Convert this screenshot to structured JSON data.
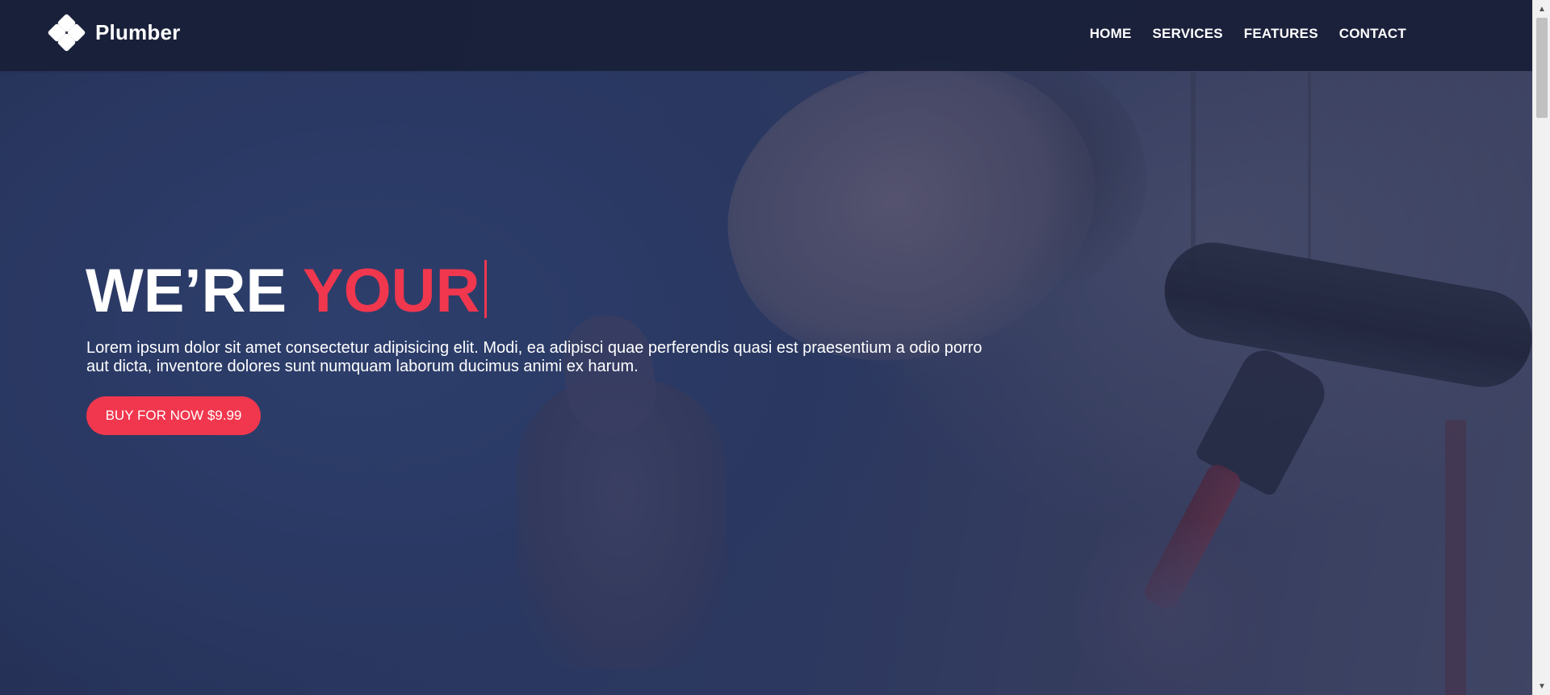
{
  "brand": {
    "name": "Plumber",
    "icon": "four-diamond-logo-icon"
  },
  "nav": {
    "items": [
      {
        "label": "HOME"
      },
      {
        "label": "SERVICES"
      },
      {
        "label": "FEATURES"
      },
      {
        "label": "CONTACT"
      }
    ]
  },
  "hero": {
    "headline_prefix": "WE’RE",
    "headline_accent": "YOUR",
    "description": "Lorem ipsum dolor sit amet consectetur adipisicing elit. Modi, ea adipisci quae perferendis quasi est praesentium a odio porro aut dicta, inventore dolores sunt numquam laborum ducimus animi ex harum.",
    "cta_label": "BUY FOR NOW $9.99",
    "background_image": "plumber-smiling-thumbs-up-with-wrench"
  },
  "colors": {
    "accent": "#f0374e",
    "navbar": "#191f38",
    "text": "#ffffff"
  },
  "scrollbar": {
    "up_icon": "scroll-up-arrow-icon",
    "down_icon": "scroll-down-arrow-icon"
  }
}
